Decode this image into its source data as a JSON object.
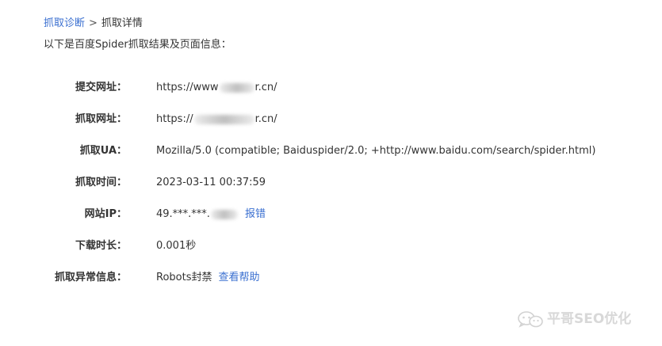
{
  "breadcrumb": {
    "parent": "抓取诊断",
    "separator": ">",
    "current": "抓取详情"
  },
  "intro": "以下是百度Spider抓取结果及页面信息：",
  "details": {
    "submit_url": {
      "label": "提交网址：",
      "value_prefix": "https://www",
      "value_suffix": "r.cn/"
    },
    "crawl_url": {
      "label": "抓取网址：",
      "value_prefix": "https://",
      "value_suffix": "r.cn/"
    },
    "crawl_ua": {
      "label": "抓取UA：",
      "value": "Mozilla/5.0 (compatible; Baiduspider/2.0; +http://www.baidu.com/search/spider.html)"
    },
    "crawl_time": {
      "label": "抓取时间：",
      "value": "2023-03-11 00:37:59"
    },
    "site_ip": {
      "label": "网站IP：",
      "value_prefix": "49.***.***.",
      "action": "报错"
    },
    "download_time": {
      "label": "下载时长：",
      "value": "0.001秒"
    },
    "crawl_error": {
      "label": "抓取异常信息：",
      "value": "Robots封禁",
      "action": "查看帮助"
    }
  },
  "watermark": {
    "text": "平哥SEO优化",
    "icon": "wechat-icon"
  },
  "colors": {
    "link": "#3a6fd0",
    "text": "#333333",
    "watermark": "#d8d8d8"
  }
}
